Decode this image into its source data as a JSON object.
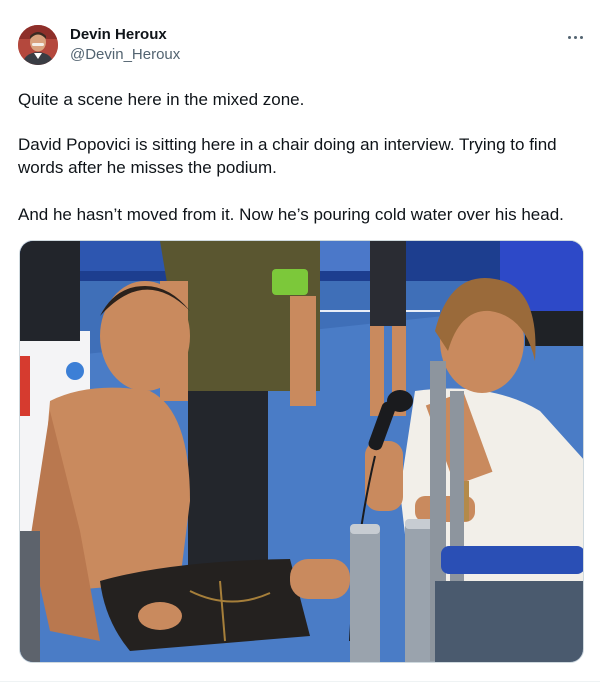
{
  "author": {
    "display_name": "Devin Heroux",
    "handle": "@Devin_Heroux",
    "avatar_icon": "profile-photo"
  },
  "more_icon": "more-options-icon",
  "tweet": {
    "paragraphs": [
      "Quite a scene here in the mixed zone.",
      "David Popovici is sitting here in a chair doing an interview. Trying to find words after he misses the podium.",
      "And he hasn’t moved from it. Now he’s pouring cold water over his head."
    ]
  },
  "media": {
    "kind": "photo",
    "colors": {
      "floor": "#3f6fb8",
      "wall": "#1d3e8f",
      "shirt_olive": "#5a5630",
      "armband": "#7cc83a",
      "skin": "#c98a5e",
      "interviewer_shirt": "#f2efe9",
      "stanchion": "#9aa3ad",
      "rope": "#2a4fb5"
    }
  }
}
